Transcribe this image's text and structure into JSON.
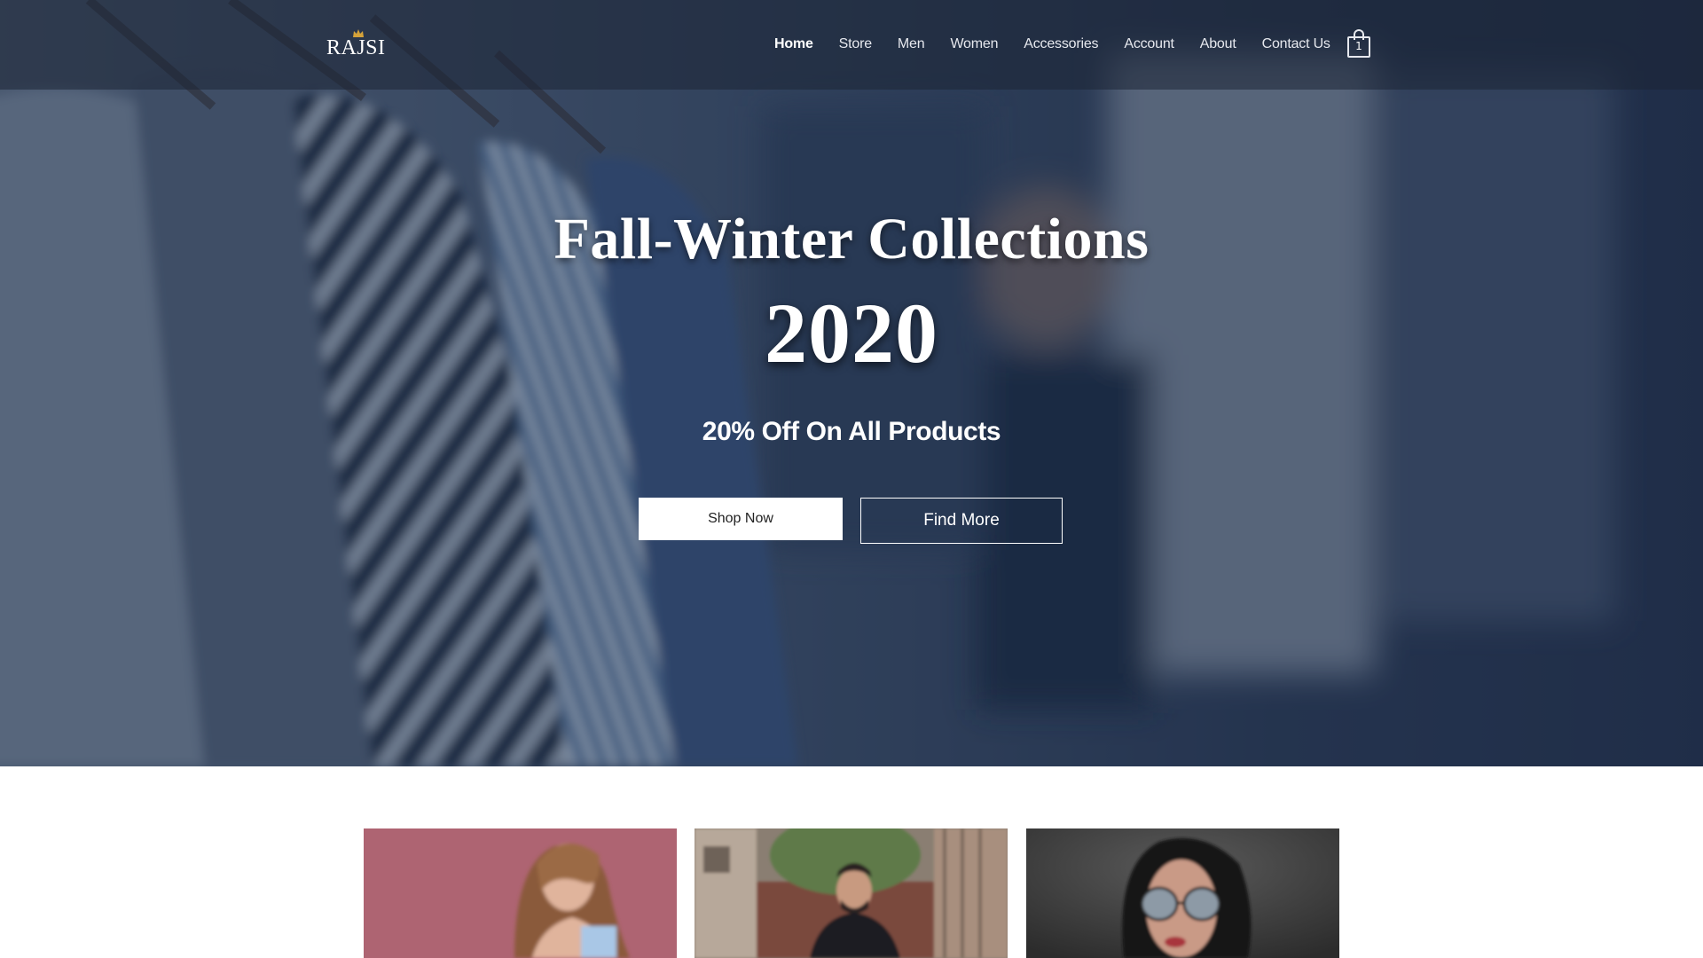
{
  "header": {
    "logo_text": "RAJSI",
    "nav": [
      {
        "label": "Home",
        "active": true
      },
      {
        "label": "Store",
        "active": false
      },
      {
        "label": "Men",
        "active": false
      },
      {
        "label": "Women",
        "active": false
      },
      {
        "label": "Accessories",
        "active": false
      },
      {
        "label": "Account",
        "active": false
      },
      {
        "label": "About",
        "active": false
      },
      {
        "label": "Contact Us",
        "active": false
      }
    ],
    "cart_icon": "shopping-bag-icon",
    "cart_count": "1"
  },
  "hero": {
    "title": "Fall-Winter Collections",
    "year": "2020",
    "subtitle": "20% Off On All Products",
    "primary_button": "Shop Now",
    "secondary_button": "Find More",
    "overlay_color": "#182a48"
  },
  "categories": [
    {
      "image": "woman-pink-background-photo",
      "accent": "#b86a78"
    },
    {
      "image": "man-street-photo",
      "accent": "#7d6a5c"
    },
    {
      "image": "woman-sunglasses-photo",
      "accent": "#3a3a3a"
    }
  ],
  "colors": {
    "header_bg": "#1c2434",
    "text_light": "#ffffff",
    "button_bg": "#ffffff"
  }
}
